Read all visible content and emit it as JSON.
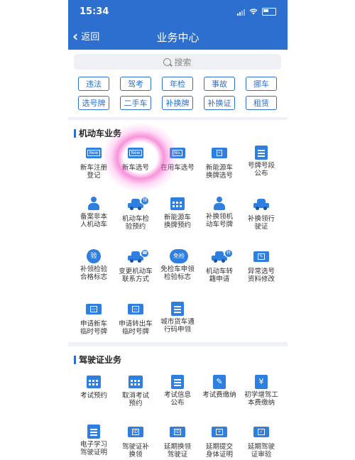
{
  "status": {
    "time": "15:34"
  },
  "nav": {
    "back_label": "返回",
    "title": "业务中心"
  },
  "search": {
    "placeholder": "搜索"
  },
  "quick_buttons": [
    [
      "违法",
      "驾考",
      "年检",
      "事故",
      "挪车"
    ],
    [
      "选号牌",
      "二手车",
      "补换牌",
      "补换证",
      "租赁"
    ]
  ],
  "sections": {
    "vehicle": {
      "title": "机动车业务",
      "items": [
        {
          "label": "新车注册\n登记",
          "icon": "new-card-icon"
        },
        {
          "label": "新车选号",
          "icon": "new-card-icon"
        },
        {
          "label": "在用车选号",
          "icon": "plate-card-icon"
        },
        {
          "label": "新能源车\n换牌选号",
          "icon": "ev-plate-icon"
        },
        {
          "label": "号牌号段\n公布",
          "icon": "document-icon"
        },
        {
          "label": "备案非本\n人机动车",
          "icon": "person-icon"
        },
        {
          "label": "机动车检\n验预约",
          "icon": "car-inspection-icon"
        },
        {
          "label": "新能源车\n换牌预约",
          "icon": "calendar-icon"
        },
        {
          "label": "补换领机\n动车号牌",
          "icon": "person-icon"
        },
        {
          "label": "补换领行\n驶证",
          "icon": "license-car-icon"
        },
        {
          "label": "补领检验\n合格标志",
          "icon": "verify-badge-icon"
        },
        {
          "label": "变更机动车\n联系方式",
          "icon": "car-phone-icon"
        },
        {
          "label": "免检车申领\n检验标志",
          "icon": "exempt-badge-icon"
        },
        {
          "label": "机动车转\n籍申请",
          "icon": "car-transfer-icon"
        },
        {
          "label": "异常选号\n资料修改",
          "icon": "edit-card-icon"
        },
        {
          "label": "申请新车\n临时号牌",
          "icon": "temp-plate-icon"
        },
        {
          "label": "申请转出车\n临时号牌",
          "icon": "temp-plate-icon"
        },
        {
          "label": "城市货车通\n行码申领",
          "icon": "truck-pass-icon"
        }
      ]
    },
    "license": {
      "title": "驾驶证业务",
      "items": [
        {
          "label": "考试预约",
          "icon": "calendar-icon"
        },
        {
          "label": "取消考试\n预约",
          "icon": "calendar-icon"
        },
        {
          "label": "考试信息\n公布",
          "icon": "document-icon"
        },
        {
          "label": "考试费缴纳",
          "icon": "pen-icon"
        },
        {
          "label": "初学增驾工\n本费缴纳",
          "icon": "yuan-icon"
        },
        {
          "label": "电子学习\n驾驶证明",
          "icon": "document-icon"
        },
        {
          "label": "驾驶证补\n换领",
          "icon": "license-icon"
        },
        {
          "label": "延期换领\n驾驶证",
          "icon": "license-icon"
        },
        {
          "label": "延期提交\n身体证明",
          "icon": "license-icon"
        },
        {
          "label": "延期驾驶\n证审验",
          "icon": "license-icon"
        }
      ]
    }
  },
  "colors": {
    "primary": "#2c6fcf",
    "icon": "#2f7fe0",
    "highlight": "#f03cbe"
  }
}
